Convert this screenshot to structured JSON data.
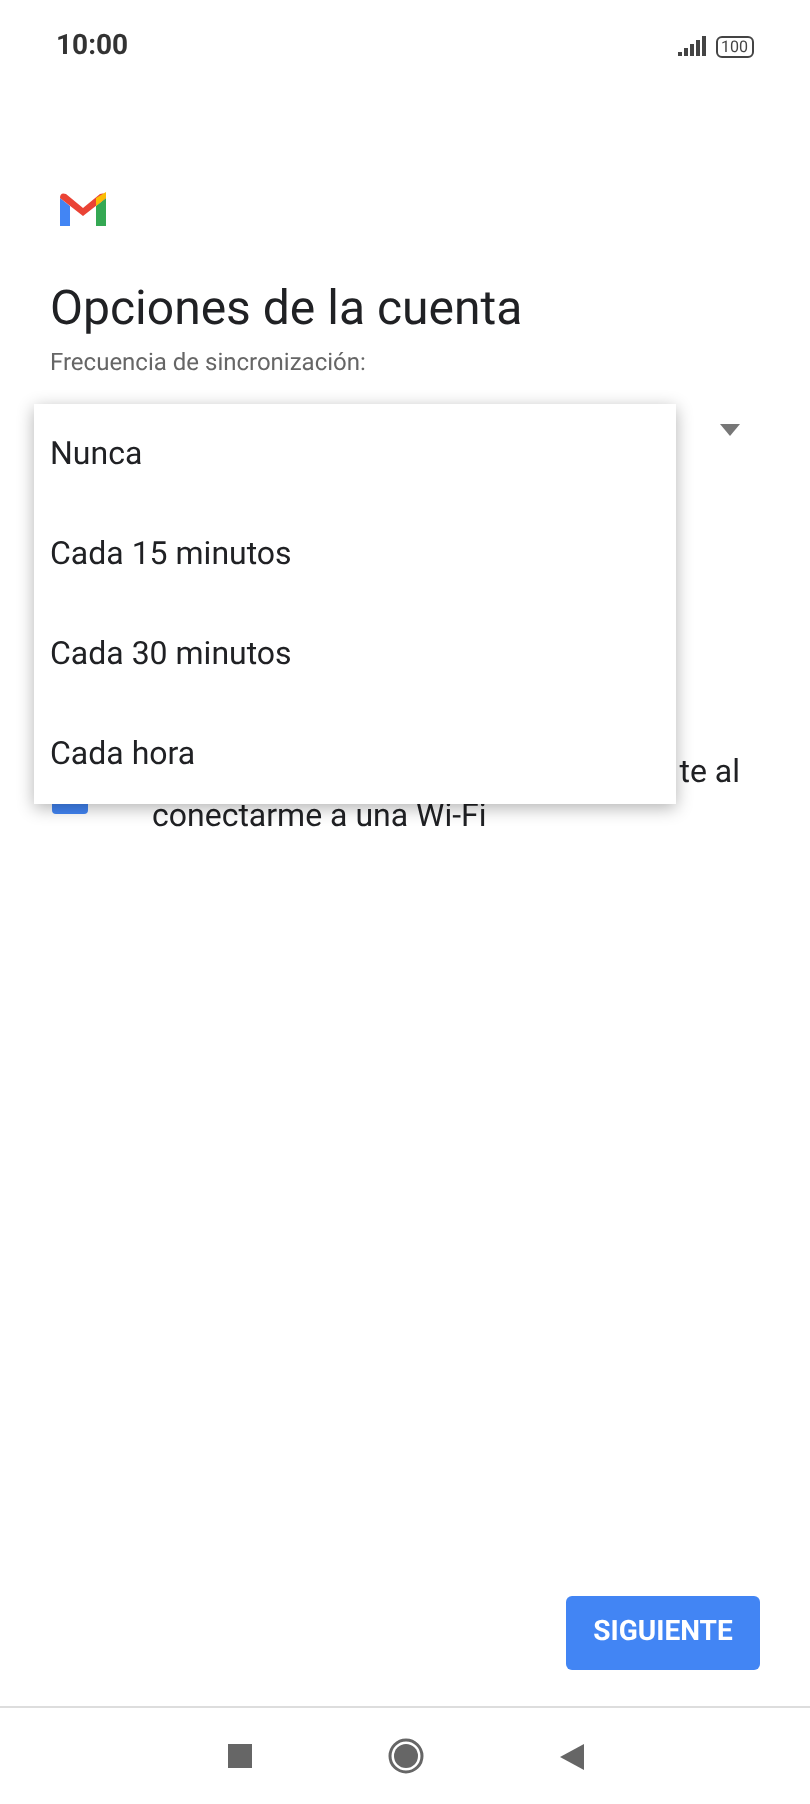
{
  "status_bar": {
    "time": "10:00",
    "battery": "100"
  },
  "title": "Opciones de la cuenta",
  "sync_frequency": {
    "label": "Frecuencia de sincronización:"
  },
  "wifi_option": {
    "checked": true,
    "line_1_visible": "te al",
    "line_2": "conectarme a una Wi-Fi"
  },
  "dropdown_menu": {
    "options": [
      {
        "label": "Nunca"
      },
      {
        "label": "Cada 15 minutos"
      },
      {
        "label": "Cada 30 minutos"
      },
      {
        "label": "Cada hora"
      }
    ]
  },
  "button": "SIGUIENTE"
}
